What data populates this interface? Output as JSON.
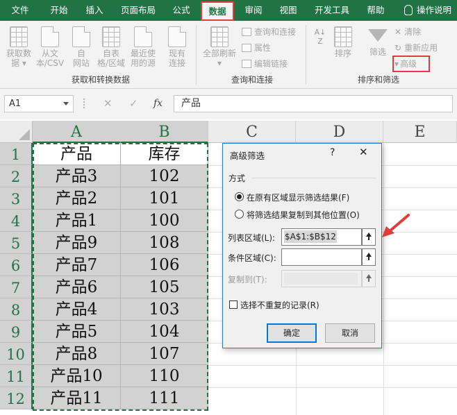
{
  "ribbon_tabs": [
    "文件",
    "开始",
    "插入",
    "页面布局",
    "公式",
    "数据",
    "审阅",
    "视图",
    "开发工具",
    "帮助",
    "操作说明"
  ],
  "active_tab": "数据",
  "ribbon": {
    "get_data": {
      "btn1": "获取数",
      "btn1b": "据 ▾",
      "btn2": "从文",
      "btn2b": "本/CSV",
      "btn3": "自",
      "btn3b": "网站",
      "btn4": "自表",
      "btn4b": "格/区域",
      "btn5": "最近使",
      "btn5b": "用的源",
      "btn6": "现有",
      "btn6b": "连接",
      "group_label": "获取和转换数据"
    },
    "queries": {
      "refresh": "全部刷新",
      "refresh_arrow": "▾",
      "queries_connections": "查询和连接",
      "properties": "属性",
      "edit_links": "编辑链接",
      "group_label": "查询和连接"
    },
    "sort_filter": {
      "sort": "排序",
      "filter": "筛选",
      "clear": "清除",
      "reapply": "重新应用",
      "advanced": "高级",
      "group_label": "排序和筛选"
    }
  },
  "formula_bar": {
    "name_box": "A1",
    "cancel_glyph": "✕",
    "enter_glyph": "✓",
    "fx_label": "fx",
    "formula": "产品"
  },
  "columns": [
    "A",
    "B",
    "C",
    "D",
    "E"
  ],
  "rows": [
    "1",
    "2",
    "3",
    "4",
    "5",
    "6",
    "7",
    "8",
    "9",
    "10",
    "11",
    "12"
  ],
  "table": [
    [
      "产品",
      "库存"
    ],
    [
      "产品3",
      "102"
    ],
    [
      "产品2",
      "101"
    ],
    [
      "产品1",
      "100"
    ],
    [
      "产品9",
      "108"
    ],
    [
      "产品7",
      "106"
    ],
    [
      "产品6",
      "105"
    ],
    [
      "产品4",
      "103"
    ],
    [
      "产品5",
      "104"
    ],
    [
      "产品8",
      "107"
    ],
    [
      "产品10",
      "110"
    ],
    [
      "产品11",
      "111"
    ]
  ],
  "dialog": {
    "title": "高级筛选",
    "help": "?",
    "close": "✕",
    "method_label": "方式",
    "option1": "在原有区域显示筛选结果(F)",
    "option2": "将筛选结果复制到其他位置(O)",
    "list_range_label": "列表区域(L):",
    "list_range_value": "$A$1:$B$12",
    "criteria_range_label": "条件区域(C):",
    "criteria_range_value": "",
    "copy_to_label": "复制到(T):",
    "copy_to_value": "",
    "unique_label": "选择不重复的记录(R)",
    "ok": "确定",
    "cancel": "取消"
  },
  "colors": {
    "excel_green": "#217346",
    "highlight_red": "#e23b3b",
    "dialog_border": "#2b79c6"
  }
}
